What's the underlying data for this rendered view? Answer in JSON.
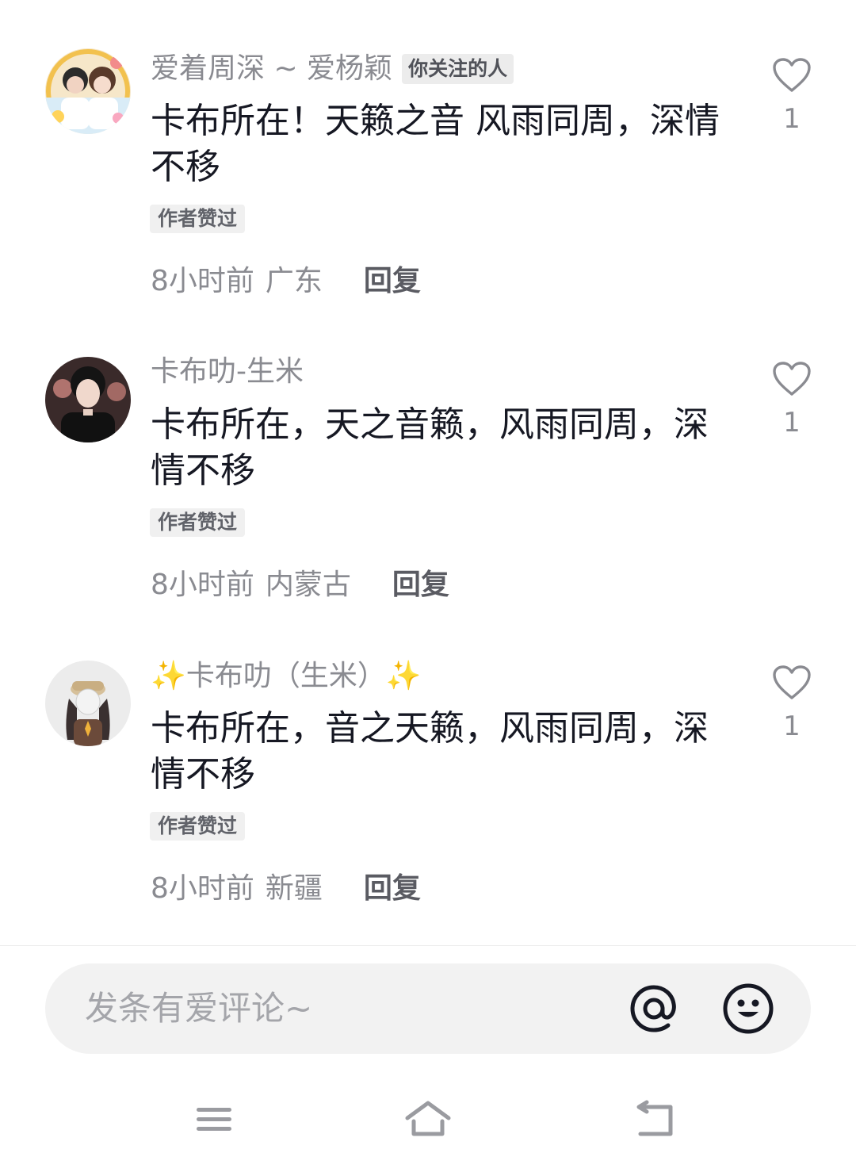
{
  "comments": [
    {
      "username": "爱着周深 ~ 爱杨颖",
      "follow_badge": "你关注的人",
      "content": "卡布所在！天籁之音 风雨同周，深情不移",
      "author_liked": "作者赞过",
      "time": "8小时前",
      "location": "广东",
      "reply": "回复",
      "like_count": "1"
    },
    {
      "username": "卡布叻-生米",
      "content": "卡布所在，天之音籁，风雨同周，深情不移",
      "author_liked": "作者赞过",
      "time": "8小时前",
      "location": "内蒙古",
      "reply": "回复",
      "like_count": "1"
    },
    {
      "username": "✨卡布叻（生米）✨",
      "content": "卡布所在，音之天籁，风雨同周，深情不移",
      "author_liked": "作者赞过",
      "time": "8小时前",
      "location": "新疆",
      "reply": "回复",
      "like_count": "1"
    }
  ],
  "input": {
    "placeholder": "发条有爱评论~"
  },
  "icons": {
    "like": "heart-outline-icon",
    "mention": "at-icon",
    "emoji": "smiley-emoji-icon",
    "nav_menu": "menu-icon",
    "nav_home": "home-icon",
    "nav_back": "back-icon"
  },
  "colors": {
    "username": "#8a8b91",
    "content": "#161823",
    "badge_bg": "#ececec",
    "input_bg": "#f2f2f2"
  }
}
